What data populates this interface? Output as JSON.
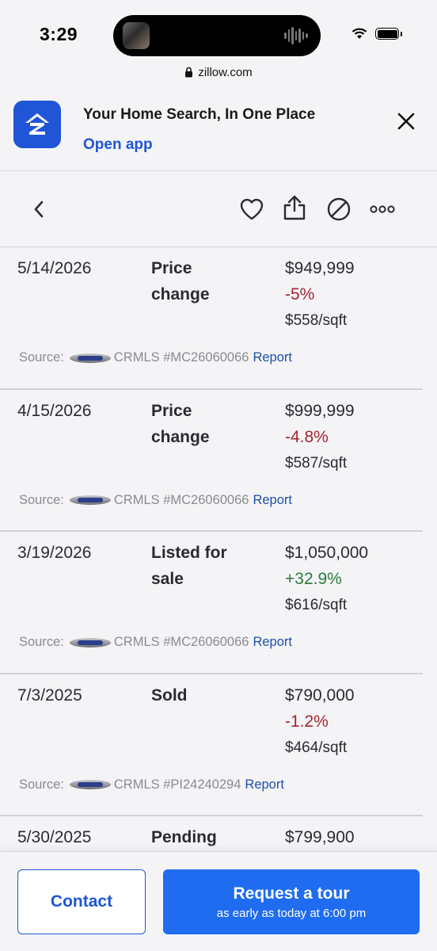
{
  "status_bar": {
    "time": "3:29"
  },
  "browser": {
    "url": "zillow.com"
  },
  "app_banner": {
    "title": "Your Home Search, In One Place",
    "link": "Open app"
  },
  "history": [
    {
      "date": "5/14/2026",
      "event": "Price change",
      "price": "$949,999",
      "change": "-5%",
      "change_direction": "negative",
      "sqft": "$558/sqft",
      "source_label": "Source:",
      "source": "CRMLS #MC26060066",
      "report": "Report"
    },
    {
      "date": "4/15/2026",
      "event": "Price change",
      "price": "$999,999",
      "change": "-4.8%",
      "change_direction": "negative",
      "sqft": "$587/sqft",
      "source_label": "Source:",
      "source": "CRMLS #MC26060066",
      "report": "Report"
    },
    {
      "date": "3/19/2026",
      "event": "Listed for sale",
      "price": "$1,050,000",
      "change": "+32.9%",
      "change_direction": "positive",
      "sqft": "$616/sqft",
      "source_label": "Source:",
      "source": "CRMLS #MC26060066",
      "report": "Report"
    },
    {
      "date": "7/3/2025",
      "event": "Sold",
      "price": "$790,000",
      "change": "-1.2%",
      "change_direction": "negative",
      "sqft": "$464/sqft",
      "source_label": "Source:",
      "source": "CRMLS #PI24240294",
      "report": "Report"
    },
    {
      "date": "5/30/2025",
      "event": "Pending",
      "price": "$799,900"
    }
  ],
  "actions": {
    "contact": "Contact",
    "tour_title": "Request a tour",
    "tour_subtitle": "as early as today at 6:00 pm"
  },
  "colors": {
    "brand_blue": "#1f55d6",
    "tour_button": "#1f6cf0",
    "negative": "#a3242e",
    "positive": "#2b7a3b"
  }
}
